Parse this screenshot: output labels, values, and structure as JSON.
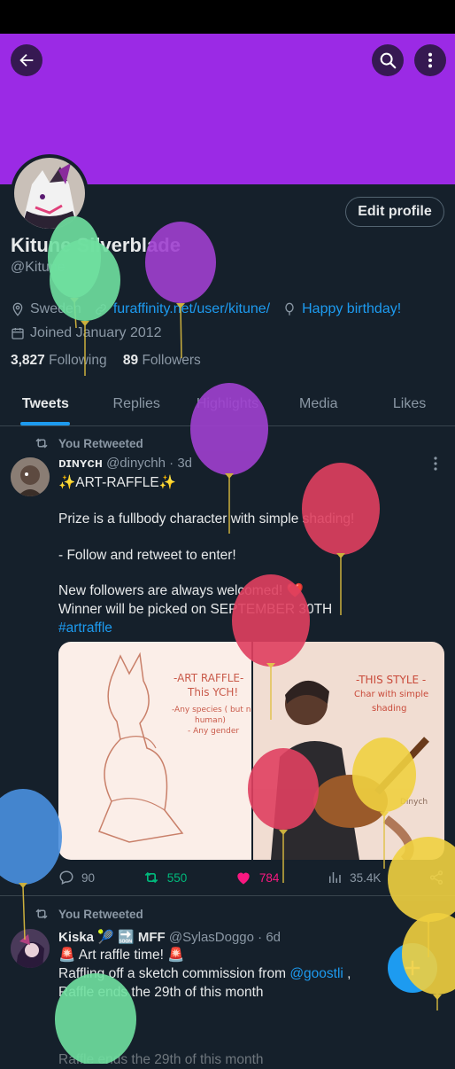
{
  "profile": {
    "name": "Kitune Silverblade",
    "handle": "@Kitune",
    "location": "Sweden",
    "website": "furaffinity.net/user/kitune/",
    "birthday": "Happy birthday!",
    "joined": "Joined January 2012",
    "following_count": "3,827",
    "following_label": "Following",
    "followers_count": "89",
    "followers_label": "Followers",
    "edit_label": "Edit profile"
  },
  "tabs": [
    "Tweets",
    "Replies",
    "Highlights",
    "Media",
    "Likes"
  ],
  "tweets": [
    {
      "retweet_label": "You Retweeted",
      "author": "ᴅɪɴʏᴄʜ",
      "handle": "@dinychh",
      "time": "· 3d",
      "lines": [
        "✨ART-RAFFLE✨",
        "Prize is a fullbody character with simple shading!",
        "- Follow and retweet to enter!",
        "New followers are always welcomed! ❤️",
        "Winner will be picked on SEPTEMBER 30TH"
      ],
      "hashtag": "#artraffle",
      "media_left_title": "-ART RAFFLE-",
      "media_left_sub": "This YCH!",
      "media_left_note1": "-Any species ( but n",
      "media_left_note2": "human)",
      "media_left_note3": "- Any gender",
      "media_right_title": "-THIS STYLE -",
      "media_right_sub": "Char with simple",
      "media_right_sub2": "shading",
      "media_right_sig": "Dinych",
      "replies": "90",
      "retweets": "550",
      "likes": "784",
      "views": "35.4K"
    },
    {
      "retweet_label": "You Retweeted",
      "author": "Kiska 🎾 🔜 MFF",
      "handle": "@SylasDoggo",
      "time": "· 6d",
      "line1": "🚨 Art raffle time! 🚨",
      "line2_prefix": "Raffling off a sketch commission from ",
      "line2_mention": "@goostli",
      "line2_suffix": " ,",
      "line3": "Raffle ends the 29th of this month",
      "line4": "Raffle ends the 29th of this month"
    }
  ],
  "colors": {
    "banner": "#9b2ae5",
    "background": "#15202b",
    "accent": "#1d9bf0",
    "retweet_green": "#00ba7c",
    "like_pink": "#f91880"
  },
  "icons": [
    "back-arrow-icon",
    "search-icon",
    "more-vertical-icon",
    "location-icon",
    "link-icon",
    "balloon-icon",
    "calendar-icon",
    "retweet-icon",
    "reply-icon",
    "like-icon",
    "views-icon",
    "share-icon",
    "plus-icon"
  ]
}
